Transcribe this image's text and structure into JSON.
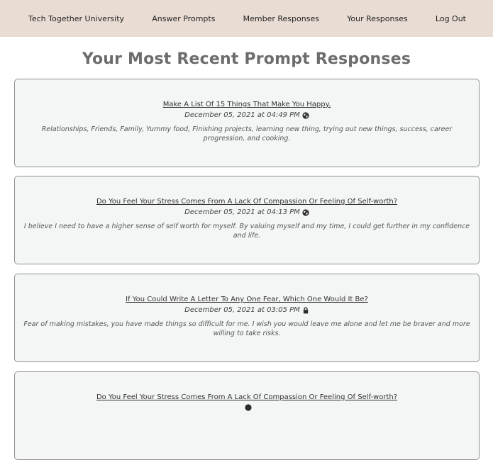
{
  "nav": {
    "brand": "Tech Together University",
    "items": [
      "Answer Prompts",
      "Member Responses",
      "Your Responses",
      "Log Out"
    ]
  },
  "page": {
    "title": "Your Most Recent Prompt Responses"
  },
  "responses": [
    {
      "prompt": "Make A List Of 15 Things That Make You Happy.",
      "date": "December 05, 2021 at 04:49 PM",
      "visibility_icon": "globe-icon",
      "response": "Relationships, Friends, Family, Yummy food, Finishing projects, learning new thing, trying out new things, success, career progression, and cooking."
    },
    {
      "prompt": "Do You Feel Your Stress Comes From A Lack Of Compassion Or Feeling Of Self-worth?",
      "date": "December 05, 2021 at 04:13 PM",
      "visibility_icon": "globe-icon",
      "response": "I believe I need to have a higher sense of self worth for myself. By valuing myself and my time, I could get further in my confidence and life."
    },
    {
      "prompt": "If You Could Write A Letter To Any One Fear, Which One Would It Be?",
      "date": "December 05, 2021 at 03:05 PM",
      "visibility_icon": "lock-icon",
      "response": "Fear of making mistakes, you have made things so difficult for me. I wish you would leave me alone and let me be braver and more willing to take risks."
    },
    {
      "prompt": "Do You Feel Your Stress Comes From A Lack Of Compassion Or Feeling Of Self-worth?",
      "date": "",
      "visibility_icon": "globe-icon",
      "response": ""
    }
  ]
}
